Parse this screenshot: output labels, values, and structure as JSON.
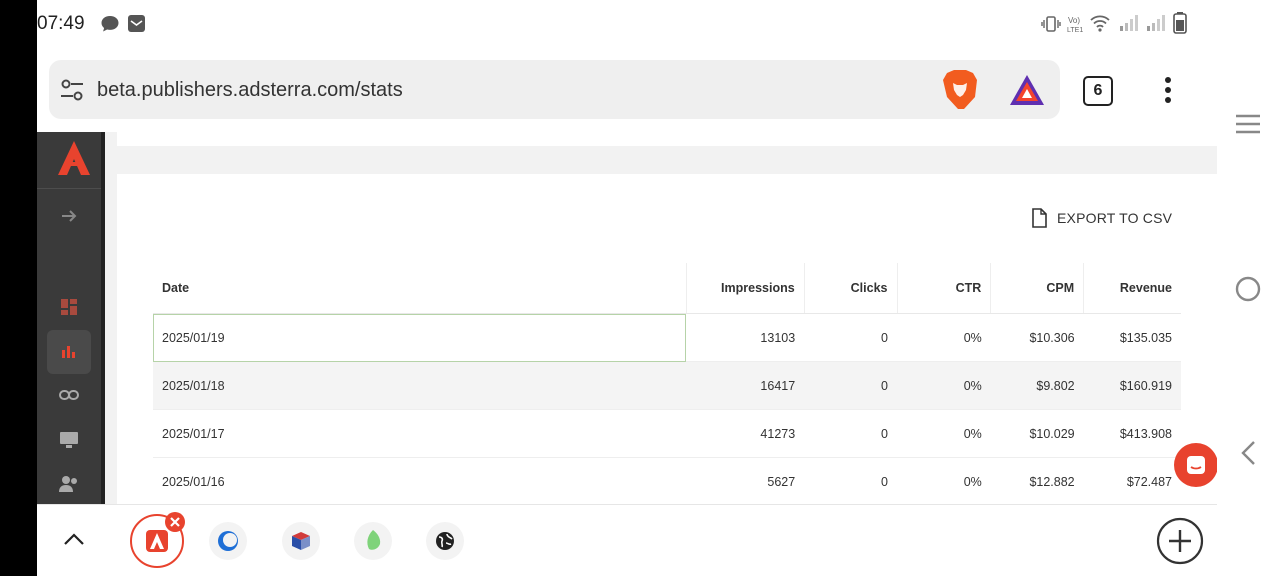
{
  "status_bar": {
    "time": "07:49"
  },
  "browser": {
    "url": "beta.publishers.adsterra.com/stats",
    "tab_count": "6"
  },
  "page": {
    "export_label": "EXPORT TO CSV",
    "table": {
      "columns": [
        "Date",
        "Impressions",
        "Clicks",
        "CTR",
        "CPM",
        "Revenue"
      ],
      "rows": [
        [
          "2025/01/19",
          "13103",
          "0",
          "0%",
          "$10.306",
          "$135.035"
        ],
        [
          "2025/01/18",
          "16417",
          "0",
          "0%",
          "$9.802",
          "$160.919"
        ],
        [
          "2025/01/17",
          "41273",
          "0",
          "0%",
          "$10.029",
          "$413.908"
        ],
        [
          "2025/01/16",
          "5627",
          "0",
          "0%",
          "$12.882",
          "$72.487"
        ]
      ]
    }
  },
  "colors": {
    "brand": "#e8432e",
    "sidebar": "#3a3a3a"
  }
}
